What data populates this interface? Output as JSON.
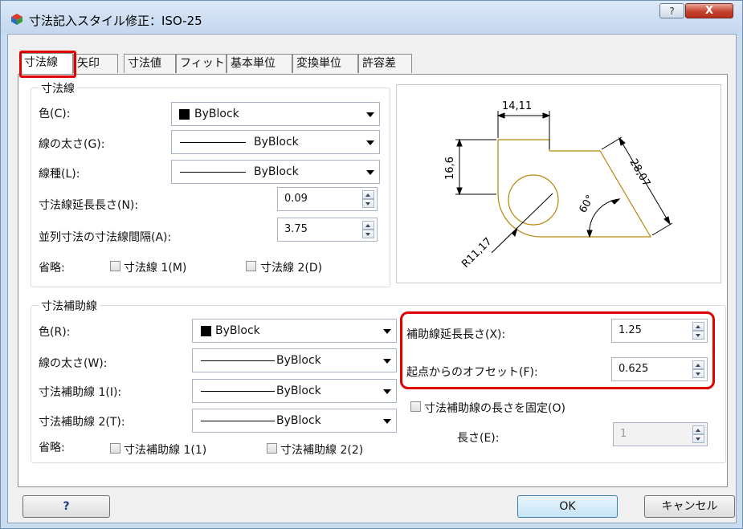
{
  "window": {
    "title": "寸法記入スタイル修正：ISO-25",
    "help_symbol": "?",
    "close_symbol": "X"
  },
  "tabs": [
    {
      "label": "寸法線"
    },
    {
      "label": "矢印"
    },
    {
      "label": "寸法値"
    },
    {
      "label": "フィット"
    },
    {
      "label": "基本単位"
    },
    {
      "label": "変換単位"
    },
    {
      "label": "許容差"
    }
  ],
  "dim_lines": {
    "group_title": "寸法線",
    "color_label": "色(C):",
    "color_value": "ByBlock",
    "lineweight_label": "線の太さ(G):",
    "lineweight_value": "ByBlock",
    "linetype_label": "線種(L):",
    "linetype_value": "ByBlock",
    "extend_label": "寸法線延長長さ(N):",
    "extend_value": "0.09",
    "baseline_label": "並列寸法の寸法線間隔(A):",
    "baseline_value": "3.75",
    "suppress_label": "省略:",
    "suppress1_label": "寸法線 1(M)",
    "suppress2_label": "寸法線 2(D)"
  },
  "ext_lines": {
    "group_title": "寸法補助線",
    "color_label": "色(R):",
    "color_value": "ByBlock",
    "lineweight_label": "線の太さ(W):",
    "lineweight_value": "ByBlock",
    "ext1_label": "寸法補助線 1(I):",
    "ext1_value": "ByBlock",
    "ext2_label": "寸法補助線 2(T):",
    "ext2_value": "ByBlock",
    "suppress_label": "省略:",
    "suppress1_label": "寸法補助線 1(1)",
    "suppress2_label": "寸法補助線 2(2)",
    "extend_beyond_label": "補助線延長長さ(X):",
    "extend_beyond_value": "1.25",
    "offset_label": "起点からのオフセット(F):",
    "offset_value": "0.625",
    "fixed_length_label": "寸法補助線の長さを固定(O)",
    "length_label": "長さ(E):",
    "length_value": "1"
  },
  "preview": {
    "dim_top": "14,11",
    "dim_left": "16,6",
    "dim_slant": "28,07",
    "dim_angle": "60°",
    "dim_radius": "R11,17",
    "geometry_color": "#b8860b"
  },
  "buttons": {
    "help": "?",
    "ok": "OK",
    "cancel": "キャンセル"
  },
  "colors": {
    "highlight": "#e00000",
    "title_bar": "#c4d7ee"
  }
}
